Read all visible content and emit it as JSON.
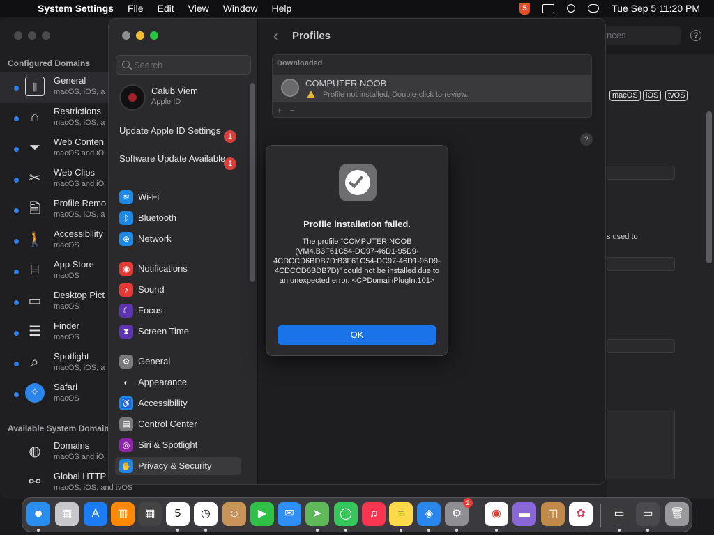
{
  "menubar": {
    "app": "System Settings",
    "menus": [
      "File",
      "Edit",
      "View",
      "Window",
      "Help"
    ],
    "clock": "Tue Sep 5  11:20 PM"
  },
  "bg_window": {
    "section_configured": "Configured Domains",
    "section_available": "Available System Domains",
    "domains": [
      {
        "title": "General",
        "sub": "macOS, iOS, a",
        "icon": "sliders-icon"
      },
      {
        "title": "Restrictions",
        "sub": "macOS, iOS, a",
        "icon": "lock-icon"
      },
      {
        "title": "Web Conten",
        "sub": "macOS and iO",
        "icon": "filter-icon"
      },
      {
        "title": "Web Clips",
        "sub": "macOS and iO",
        "icon": "scissors-icon"
      },
      {
        "title": "Profile Remo",
        "sub": "macOS, iOS, a",
        "icon": "profile-removal-icon"
      },
      {
        "title": "Accessibility",
        "sub": "macOS",
        "icon": "accessibility-icon"
      },
      {
        "title": "App Store",
        "sub": "macOS",
        "icon": "store-icon"
      },
      {
        "title": "Desktop Pict",
        "sub": "macOS",
        "icon": "desktop-icon"
      },
      {
        "title": "Finder",
        "sub": "macOS",
        "icon": "finder-icon"
      },
      {
        "title": "Spotlight",
        "sub": "macOS, iOS, a",
        "icon": "magnifier-icon"
      },
      {
        "title": "Safari",
        "sub": "macOS",
        "icon": "compass-icon"
      }
    ],
    "available": [
      {
        "title": "Domains",
        "sub": "macOS and iO",
        "icon": "globe-icon"
      },
      {
        "title": "Global HTTP",
        "sub": "macOS, iOS, and tvOS",
        "icon": "proxy-icon"
      }
    ],
    "search_placeholder": "nces",
    "platforms": [
      "macOS",
      "iOS",
      "tvOS"
    ],
    "partial_text": "s used to"
  },
  "settings": {
    "search_placeholder": "Search",
    "account": {
      "name": "Calub Viem",
      "sub": "Apple ID"
    },
    "notices": [
      {
        "label": "Update Apple ID Settings",
        "badge": "1"
      },
      {
        "label": "Software Update Available",
        "badge": "1"
      }
    ],
    "nav": [
      {
        "label": "Wi-Fi",
        "icon": "wifi-icon",
        "color": "#1e88e5",
        "glyph": "≋"
      },
      {
        "label": "Bluetooth",
        "icon": "bluetooth-icon",
        "color": "#1e88e5",
        "glyph": "ᛒ"
      },
      {
        "label": "Network",
        "icon": "network-icon",
        "color": "#1e88e5",
        "glyph": "⊕"
      },
      {
        "label": "Notifications",
        "icon": "bell-icon",
        "color": "#e53935",
        "glyph": "◉"
      },
      {
        "label": "Sound",
        "icon": "speaker-icon",
        "color": "#e53935",
        "glyph": "♪"
      },
      {
        "label": "Focus",
        "icon": "moon-icon",
        "color": "#5e35b1",
        "glyph": "☾"
      },
      {
        "label": "Screen Time",
        "icon": "hourglass-icon",
        "color": "#5e35b1",
        "glyph": "⧗"
      },
      {
        "label": "General",
        "icon": "gear-icon",
        "color": "#7a7a7d",
        "glyph": "⚙"
      },
      {
        "label": "Appearance",
        "icon": "appearance-icon",
        "color": "#2a2a2a",
        "glyph": "◐"
      },
      {
        "label": "Accessibility",
        "icon": "accessibility-icon",
        "color": "#1e88e5",
        "glyph": "♿"
      },
      {
        "label": "Control Center",
        "icon": "control-center-icon",
        "color": "#7a7a7d",
        "glyph": "▤"
      },
      {
        "label": "Siri & Spotlight",
        "icon": "siri-icon",
        "color": "#8e24aa",
        "glyph": "◎"
      },
      {
        "label": "Privacy & Security",
        "icon": "hand-icon",
        "color": "#1e88e5",
        "glyph": "✋"
      }
    ],
    "page_title": "Profiles",
    "downloaded_header": "Downloaded",
    "profile": {
      "name": "COMPUTER NOOB",
      "status": "Profile not installed. Double-click to review."
    },
    "plus": "+",
    "minus": "−",
    "help": "?"
  },
  "alert": {
    "title": "Profile installation failed.",
    "message": "The profile “COMPUTER NOOB (VM4.B3F61C54-DC97-46D1-95D9-4CDCCD6BDB7D:B3F61C54-DC97-46D1-95D9-4CDCCD6BDB7D)” could not be installed due to an unexpected error. <CPDomainPlugIn:101>",
    "ok": "OK"
  },
  "dock": {
    "apps": [
      {
        "name": "finder",
        "color": "#2a8df0",
        "glyph": "☻"
      },
      {
        "name": "launchpad",
        "color": "#c7c7cc",
        "glyph": "▦"
      },
      {
        "name": "app-store",
        "color": "#1c7cf4",
        "glyph": "A"
      },
      {
        "name": "books",
        "color": "#ff8a00",
        "glyph": "▥"
      },
      {
        "name": "calculator",
        "color": "#444",
        "glyph": "▦"
      },
      {
        "name": "calendar",
        "color": "#ffffff",
        "glyph": "5",
        "text": "#222"
      },
      {
        "name": "clock",
        "color": "#ffffff",
        "glyph": "◷",
        "text": "#222"
      },
      {
        "name": "contacts",
        "color": "#c9945a",
        "glyph": "☺"
      },
      {
        "name": "facetime",
        "color": "#30c048",
        "glyph": "▶"
      },
      {
        "name": "mail",
        "color": "#2f8ff5",
        "glyph": "✉"
      },
      {
        "name": "maps",
        "color": "#5fb85a",
        "glyph": "➤"
      },
      {
        "name": "messages",
        "color": "#35c759",
        "glyph": "◯"
      },
      {
        "name": "music",
        "color": "#fa3550",
        "glyph": "♫"
      },
      {
        "name": "notes",
        "color": "#ffd94a",
        "glyph": "≡",
        "text": "#555"
      },
      {
        "name": "safari",
        "color": "#2a86ea",
        "glyph": "◈"
      },
      {
        "name": "system-settings",
        "color": "#8e8e93",
        "glyph": "⚙",
        "badge": "2"
      },
      {
        "name": "chrome",
        "color": "#ffffff",
        "glyph": "◉",
        "text": "#db4437"
      },
      {
        "name": "utility",
        "color": "#8a67d6",
        "glyph": "▬"
      },
      {
        "name": "package",
        "color": "#c08a4a",
        "glyph": "◫"
      },
      {
        "name": "config-tool",
        "color": "#ffffff",
        "glyph": "✿",
        "text": "#e2375f"
      },
      {
        "name": "window-thumb",
        "color": "#3a3a3c",
        "glyph": "▭"
      },
      {
        "name": "window-thumb-2",
        "color": "#4a4a4c",
        "glyph": "▭"
      },
      {
        "name": "trash",
        "color": "#9a9a9d",
        "glyph": "🗑"
      }
    ]
  }
}
